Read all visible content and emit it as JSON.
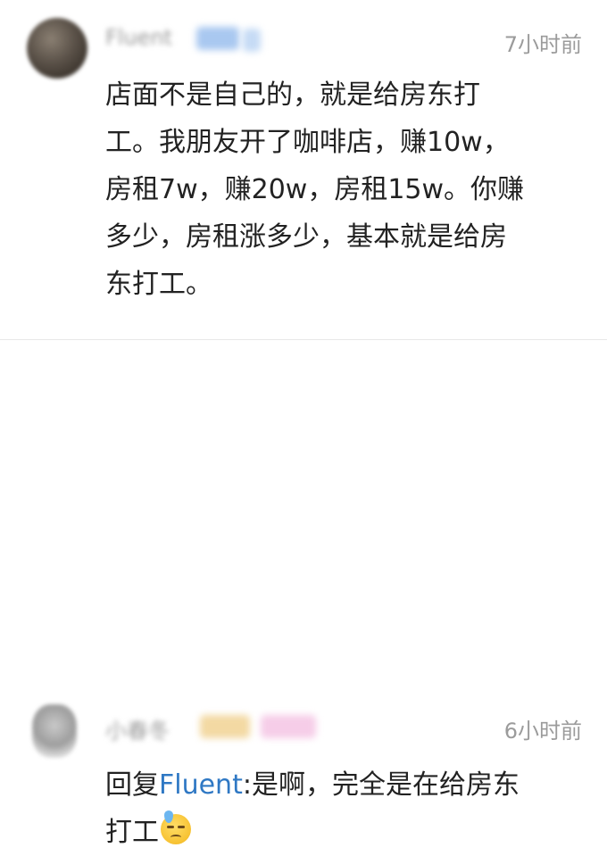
{
  "comments": [
    {
      "username": "Fluent",
      "time": "7小时前",
      "lines": [
        "店面不是自己的，就是给房东打",
        "工。我朋友开了咖啡店，赚10w，",
        "房租7w，赚20w，房租15w。你赚",
        "多少，房租涨多少，基本就是给房",
        "东打工。"
      ]
    },
    {
      "username": "小春冬",
      "time": "6小时前",
      "reply_prefix": "回复",
      "reply_to": "Fluent",
      "reply_text_1": ":是啊，完全是在给房东",
      "reply_text_2": "打工",
      "emoji": "anxious-sweat-face"
    }
  ],
  "colors": {
    "mention": "#2f78c4",
    "timestamp": "#9b9b9b",
    "text": "#222222"
  }
}
